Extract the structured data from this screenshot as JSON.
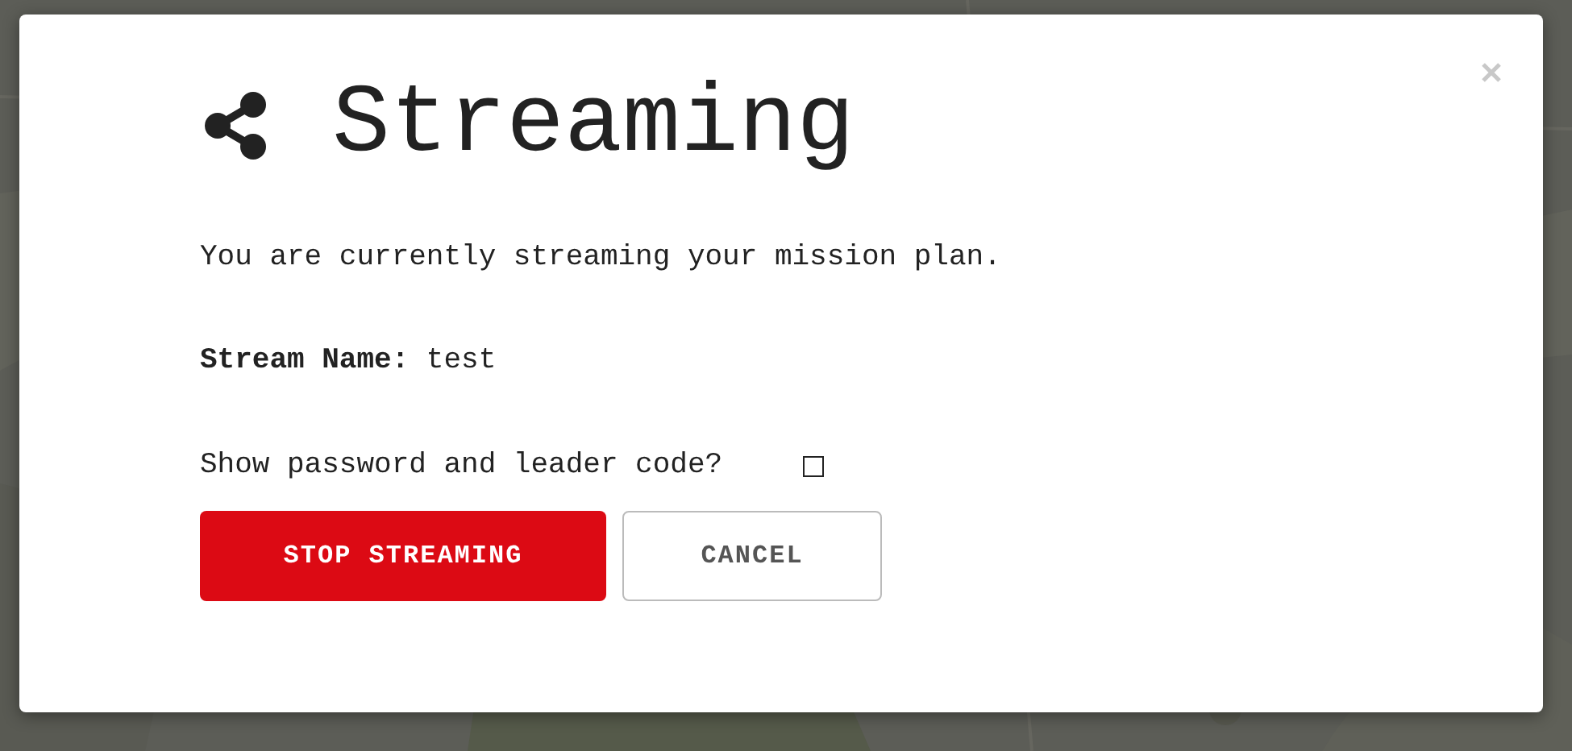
{
  "dialog": {
    "title": "Streaming",
    "message": "You are currently streaming your mission plan.",
    "stream_name": {
      "label": "Stream Name:",
      "value": "test"
    },
    "show_codes": {
      "label": "Show password and leader code?",
      "checked": false
    },
    "buttons": [
      {
        "label": "STOP STREAMING",
        "kind": "danger"
      },
      {
        "label": "CANCEL",
        "kind": "plain"
      }
    ]
  }
}
